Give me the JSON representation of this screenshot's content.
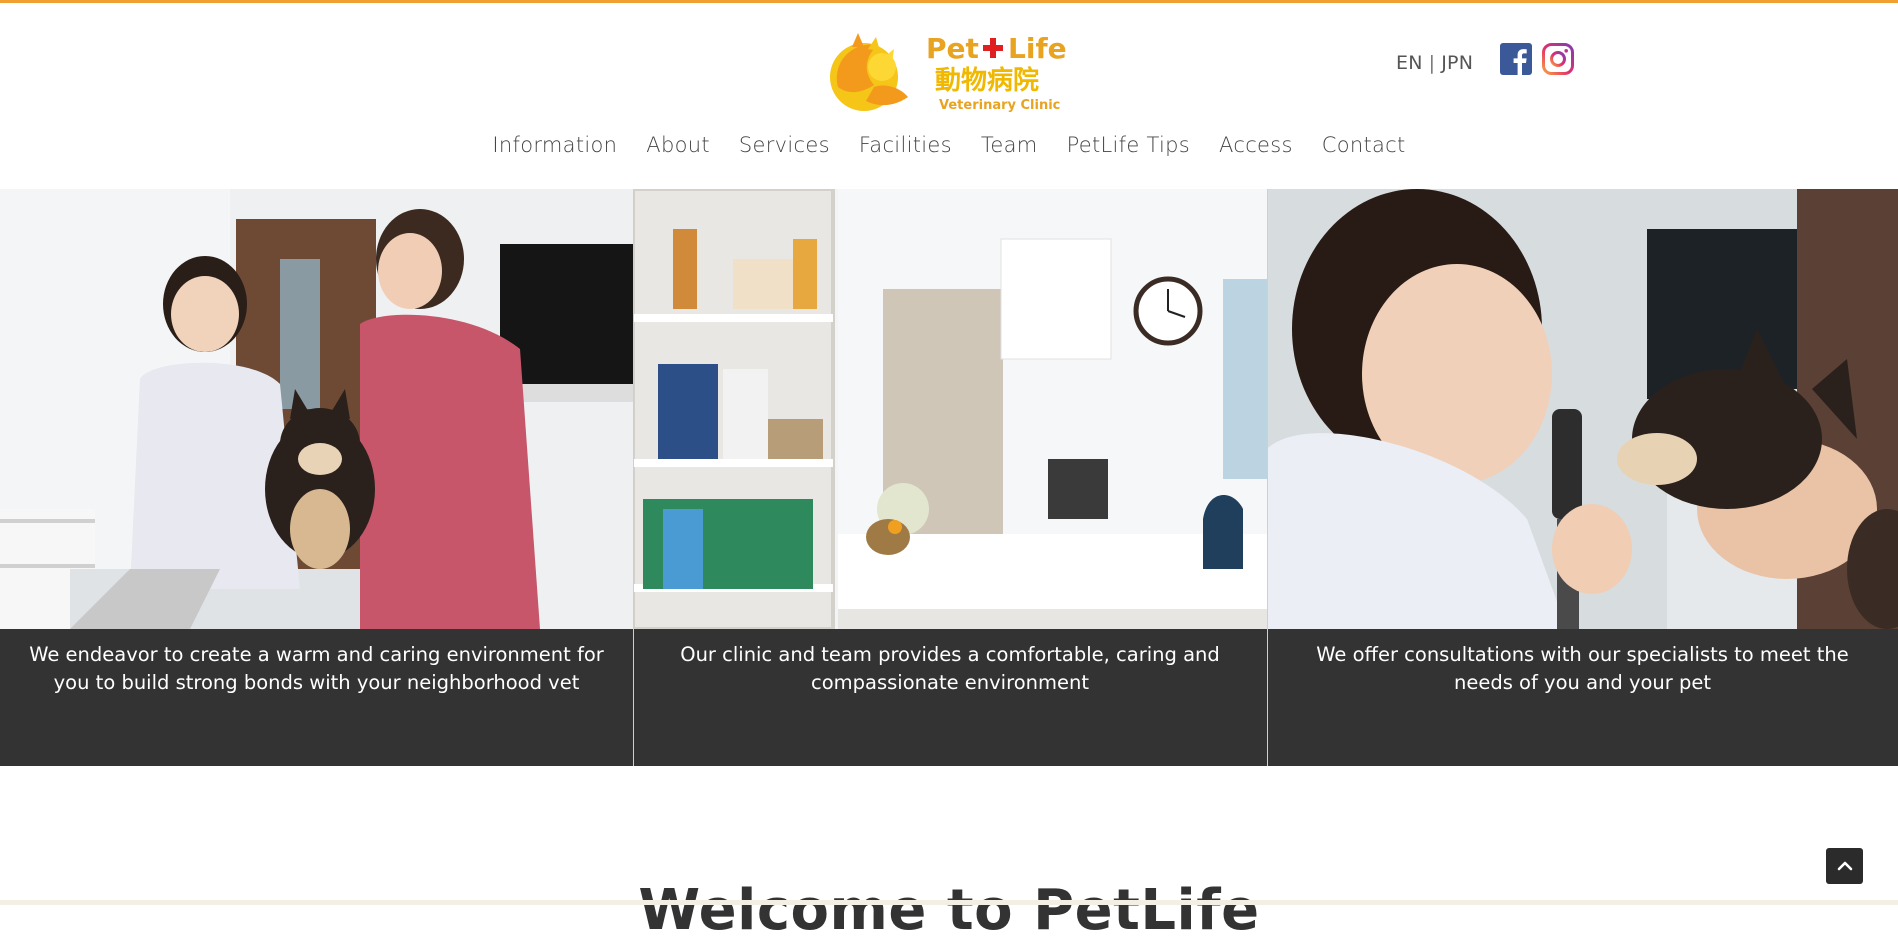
{
  "brand": {
    "name_en_part1": "Pet",
    "name_en_part2": "Life",
    "name_jp": "動物病院",
    "tagline": "Veterinary Clinic",
    "accent_orange": "#f0a030",
    "logo_text_color": "#e8a320",
    "cross_color": "#e02020"
  },
  "header": {
    "lang_en": "EN",
    "lang_separator": "|",
    "lang_jp": "JPN",
    "social": [
      "facebook-icon",
      "instagram-icon"
    ]
  },
  "nav": {
    "items": [
      {
        "label": "Information"
      },
      {
        "label": "About"
      },
      {
        "label": "Services"
      },
      {
        "label": "Facilities"
      },
      {
        "label": "Team"
      },
      {
        "label": "PetLife Tips"
      },
      {
        "label": "Access"
      },
      {
        "label": "Contact"
      }
    ]
  },
  "hero": {
    "panels": [
      {
        "photo": "vet-examining-shiba-dog",
        "caption": "We endeavor to create a warm and caring environment for you to build strong bonds with your neighborhood vet"
      },
      {
        "photo": "clinic-reception-and-shelves",
        "caption": "Our clinic and team provides a comfortable, caring and compassionate environment"
      },
      {
        "photo": "vet-otoscope-dog-ear",
        "caption": "We offer consultations with our specialists to meet the needs of you and your pet"
      }
    ],
    "caption_bg": "#333333"
  },
  "main": {
    "welcome_title": "Welcome to PetLife"
  },
  "controls": {
    "back_to_top_icon": "chevron-up-icon"
  }
}
